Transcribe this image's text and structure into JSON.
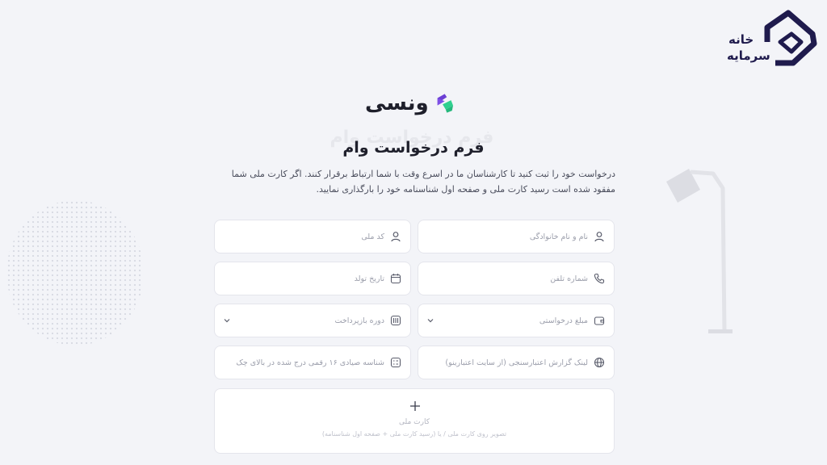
{
  "corner_brand": {
    "line1": "خانه",
    "line2": "سرمایه"
  },
  "brand": {
    "name": "ونسی"
  },
  "form": {
    "ghost_title": "فرم درخواست وام",
    "title": "فرم درخواست وام",
    "description": "درخواست خود را ثبت کنید تا کارشناسان ما در اسرع وقت با شما ارتباط برقرار کنند. اگر کارت ملی شما مفقود شده است رسید کارت ملی و صفحه اول شناسنامه خود را بارگذاری نمایید.",
    "fields": {
      "full_name": "نام و نام خانوادگی",
      "national_code": "کد ملی",
      "phone": "شماره تلفن",
      "birth_date": "تاریخ تولد",
      "loan_amount": "مبلغ درخواستی",
      "repayment_period": "دوره بازپرداخت",
      "credit_report_link": "لینک گزارش اعتبارسنجی (از سایت اعتبارینو)",
      "sayad_id": "شناسه صیادی ۱۶ رقمی درج شده در بالای چک"
    },
    "upload": {
      "title": "کارت ملی",
      "hint": "تصویر روی کارت ملی / یا (رسید کارت ملی + صفحه اول شناسنامه)"
    }
  },
  "colors": {
    "background": "#f3f4f8",
    "brand_purple": "#6c3fd4",
    "brand_green": "#2fd08f",
    "corner_logo": "#1f1b4d"
  }
}
